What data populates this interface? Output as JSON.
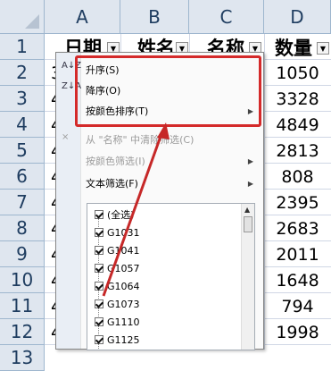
{
  "columns": [
    "A",
    "B",
    "C",
    "D"
  ],
  "rows": [
    "1",
    "2",
    "3",
    "4",
    "5",
    "6",
    "7",
    "8",
    "9",
    "10",
    "11",
    "12",
    "13"
  ],
  "header_cells": [
    "日期",
    "姓名",
    "名称",
    "数量"
  ],
  "col_a_partial": [
    "3",
    "4",
    "4",
    "4",
    "4",
    "4",
    "4",
    "4",
    "4",
    "4",
    "4"
  ],
  "quantities": [
    "1050",
    "3328",
    "4849",
    "2813",
    "808",
    "2395",
    "2683",
    "2011",
    "1648",
    "794",
    "1998"
  ],
  "menu": {
    "sort_asc": "升序(S)",
    "sort_desc": "降序(O)",
    "sort_by_color": "按颜色排序(T)",
    "clear_filter": "从 \"名称\" 中清除筛选(C)",
    "filter_by_color": "按颜色筛选(I)",
    "text_filter": "文本筛选(F)"
  },
  "filter_list": [
    "(全选)",
    "G1031",
    "G1041",
    "G1057",
    "G1064",
    "G1073",
    "G1110",
    "G1125"
  ],
  "colors": {
    "highlight": "#d42a2a",
    "arrow": "#c62828",
    "header_bg": "#dfe6ef"
  }
}
